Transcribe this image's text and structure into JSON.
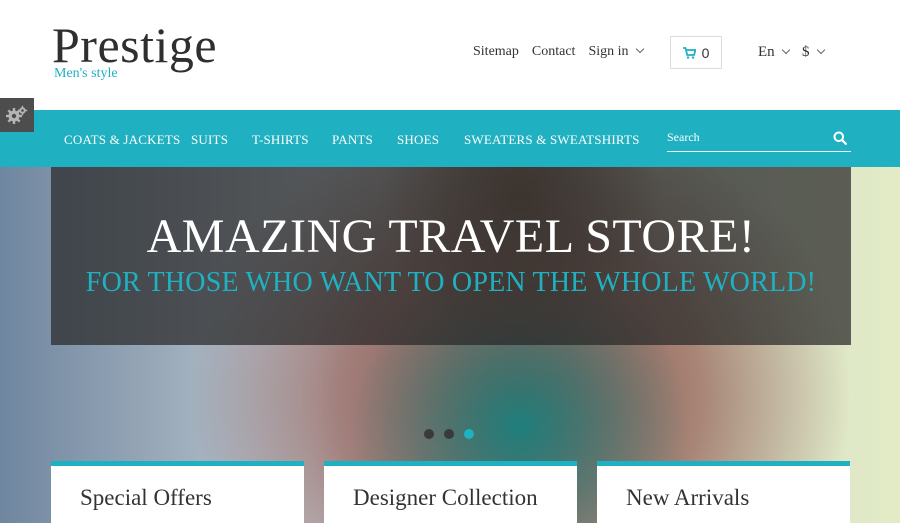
{
  "header": {
    "logo_title": "Prestige",
    "logo_subtitle": "Men's style",
    "links": [
      "Sitemap",
      "Contact",
      "Sign in"
    ],
    "cart_count": "0",
    "language": "En",
    "currency": "$"
  },
  "nav": {
    "items": [
      "COATS & JACKETS",
      "SUITS",
      "T-SHIRTS",
      "PANTS",
      "SHOES",
      "SWEATERS & SWEATSHIRTS"
    ],
    "search_placeholder": "Search"
  },
  "hero": {
    "title": "AMAZING TRAVEL STORE!",
    "subtitle": "FOR THOSE WHO WANT TO OPEN THE WHOLE WORLD!",
    "slide_count": 3,
    "active_slide": 3
  },
  "boxes": [
    "Special Offers",
    "Designer Collection",
    "New Arrivals"
  ],
  "colors": {
    "accent": "#1fb1c1",
    "text": "#333333",
    "gear_tab": "#4d4d4d"
  },
  "icons": [
    "gear-icon",
    "cart-icon",
    "search-icon",
    "chevron-down-icon"
  ]
}
